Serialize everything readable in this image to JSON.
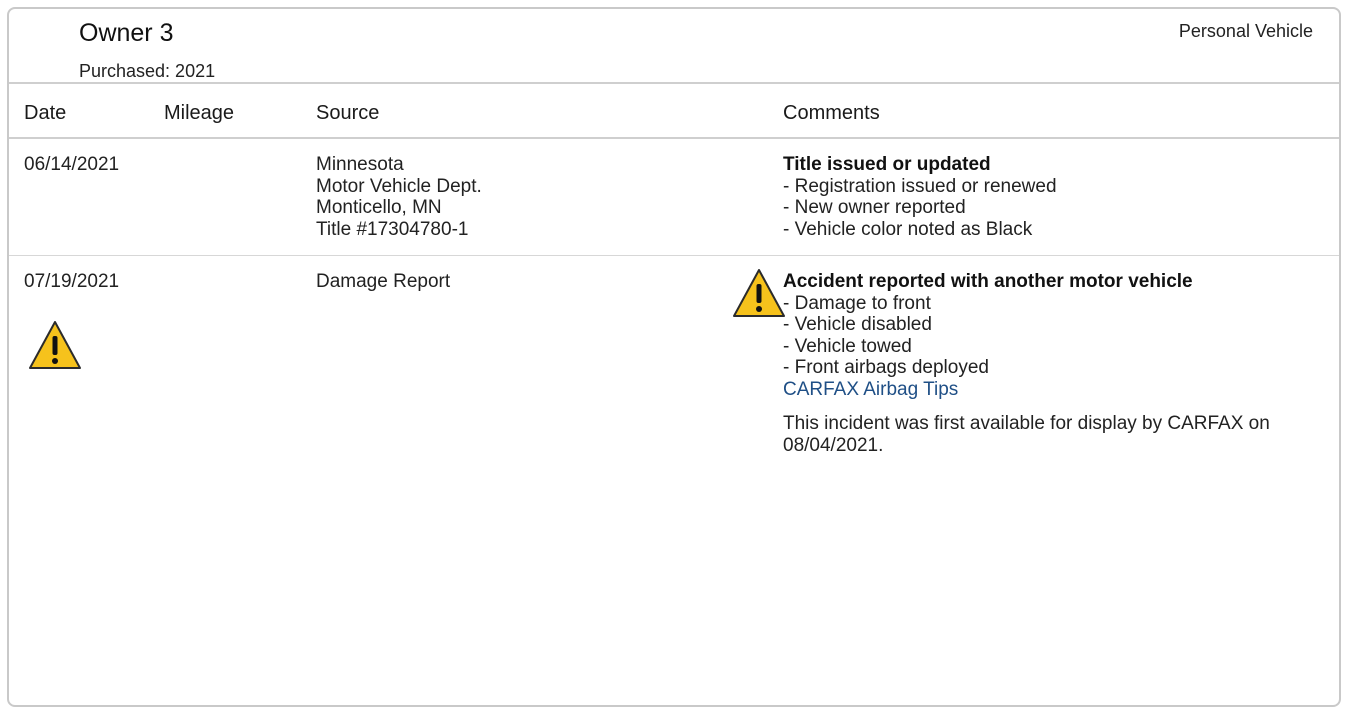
{
  "owner": {
    "title": "Owner 3",
    "purchased": "Purchased: 2021",
    "usage": "Personal Vehicle"
  },
  "table": {
    "headers": [
      "Date",
      "Mileage",
      "Source",
      "Comments"
    ],
    "rows": [
      {
        "date": "06/14/2021",
        "mileage": "",
        "source": [
          "Minnesota",
          "Motor Vehicle Dept.",
          "Monticello, MN",
          "Title #17304780-1"
        ],
        "comment_title": "Title issued or updated",
        "comment_lines": [
          "- Registration issued or renewed",
          "- New owner reported",
          "- Vehicle color noted as Black"
        ]
      },
      {
        "date": "07/19/2021",
        "mileage": "",
        "source": [
          "Damage Report"
        ],
        "comment_title": "Accident reported with another motor vehicle",
        "comment_lines": [
          "- Damage to front",
          "- Vehicle disabled",
          "- Vehicle towed",
          "- Front airbags deployed"
        ],
        "link": "CARFAX Airbag Tips",
        "note": "This incident was first available for display by CARFAX on 08/04/2021.",
        "icons": [
          "warning-icon",
          "warning-icon"
        ]
      }
    ]
  },
  "colors": {
    "border": "#c9c9c9",
    "link": "#1f4f86",
    "warning_fill": "#f6c21c",
    "warning_stroke": "#2b2b2b"
  }
}
